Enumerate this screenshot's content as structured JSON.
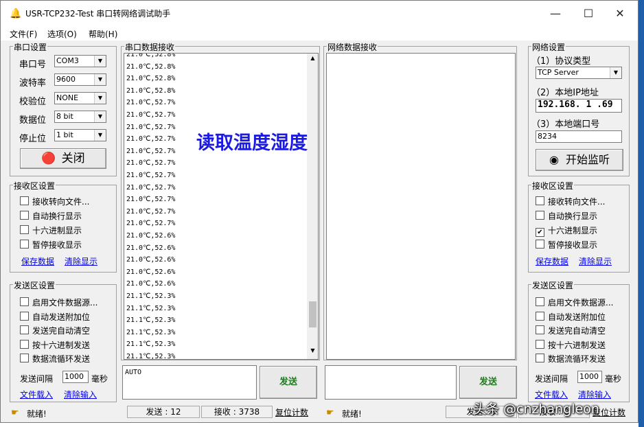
{
  "window": {
    "title": "USR-TCP232-Test 串口转网络调试助手",
    "app_icon": "bell-icon",
    "controls": {
      "minimize": "—",
      "maximize": "☐",
      "close": "✕"
    }
  },
  "menu": [
    "文件(F)",
    "选项(O)",
    "帮助(H)"
  ],
  "serial_settings": {
    "title": "串口设置",
    "rows": [
      {
        "label": "串口号",
        "value": "COM3"
      },
      {
        "label": "波特率",
        "value": "9600"
      },
      {
        "label": "校验位",
        "value": "NONE"
      },
      {
        "label": "数据位",
        "value": "8 bit"
      },
      {
        "label": "停止位",
        "value": "1 bit"
      }
    ],
    "close_button": "关闭"
  },
  "left_receive_settings": {
    "title": "接收区设置",
    "checkboxes": [
      {
        "label": "接收转向文件...",
        "checked": false
      },
      {
        "label": "自动换行显示",
        "checked": false
      },
      {
        "label": "十六进制显示",
        "checked": false
      },
      {
        "label": "暂停接收显示",
        "checked": false
      }
    ],
    "links": [
      "保存数据",
      "清除显示"
    ]
  },
  "left_send_settings": {
    "title": "发送区设置",
    "checkboxes": [
      {
        "label": "启用文件数据源...",
        "checked": false
      },
      {
        "label": "自动发送附加位",
        "checked": false
      },
      {
        "label": "发送完自动清空",
        "checked": false
      },
      {
        "label": "按十六进制发送",
        "checked": false
      },
      {
        "label": "数据流循环发送",
        "checked": false
      }
    ],
    "interval_label": "发送间隔",
    "interval_value": "1000",
    "interval_unit": "毫秒",
    "links": [
      "文件载入",
      "清除输入"
    ]
  },
  "serial_receive": {
    "title": "串口数据接收",
    "lines": [
      "21.0℃,52.8%",
      "21.0℃,52.8%",
      "21.0℃,52.8%",
      "21.0℃,52.8%",
      "21.0℃,52.7%",
      "21.0℃,52.7%",
      "21.0℃,52.7%",
      "21.0℃,52.7%",
      "21.0℃,52.7%",
      "21.0℃,52.7%",
      "21.0℃,52.7%",
      "21.0℃,52.7%",
      "21.0℃,52.7%",
      "21.0℃,52.7%",
      "21.0℃,52.7%",
      "21.0℃,52.6%",
      "21.0℃,52.6%",
      "21.0℃,52.6%",
      "21.0℃,52.6%",
      "21.0℃,52.6%",
      "21.1℃,52.3%",
      "21.1℃,52.3%",
      "21.1℃,52.3%",
      "21.1℃,52.3%",
      "21.1℃,52.3%",
      "21.1℃,52.3%"
    ],
    "overlay_caption": "读取温度湿度"
  },
  "serial_send": {
    "input_value": "AUTO",
    "send_button": "发送"
  },
  "network_receive": {
    "title": "网络数据接收"
  },
  "network_send": {
    "send_button": "发送"
  },
  "network_settings": {
    "title": "网络设置",
    "protocol_label": "（1）协议类型",
    "protocol_value": "TCP Server",
    "ip_label": "（2）本地IP地址",
    "ip_value": "192.168. 1 .69",
    "port_label": "（3）本地端口号",
    "port_value": "8234",
    "listen_button": "开始监听"
  },
  "right_receive_settings": {
    "title": "接收区设置",
    "checkboxes": [
      {
        "label": "接收转向文件...",
        "checked": false
      },
      {
        "label": "自动换行显示",
        "checked": false
      },
      {
        "label": "十六进制显示",
        "checked": true
      },
      {
        "label": "暂停接收显示",
        "checked": false
      }
    ],
    "links": [
      "保存数据",
      "清除显示"
    ]
  },
  "right_send_settings": {
    "title": "发送区设置",
    "checkboxes": [
      {
        "label": "启用文件数据源...",
        "checked": false
      },
      {
        "label": "自动发送附加位",
        "checked": false
      },
      {
        "label": "发送完自动清空",
        "checked": false
      },
      {
        "label": "按十六进制发送",
        "checked": false
      },
      {
        "label": "数据流循环发送",
        "checked": false
      }
    ],
    "interval_label": "发送间隔",
    "interval_value": "1000",
    "interval_unit": "毫秒",
    "links": [
      "文件载入",
      "清除输入"
    ]
  },
  "statusbar": {
    "left_ready": "就绪!",
    "send_count": "发送 : 12",
    "recv_count": "接收 : 3738",
    "reset": "复位计数",
    "right_ready": "就绪!",
    "right_send": "发送 : 0",
    "right_recv": "接收 : 0",
    "right_reset": "复位计数"
  },
  "watermark": "头条 @cnzhangleon"
}
